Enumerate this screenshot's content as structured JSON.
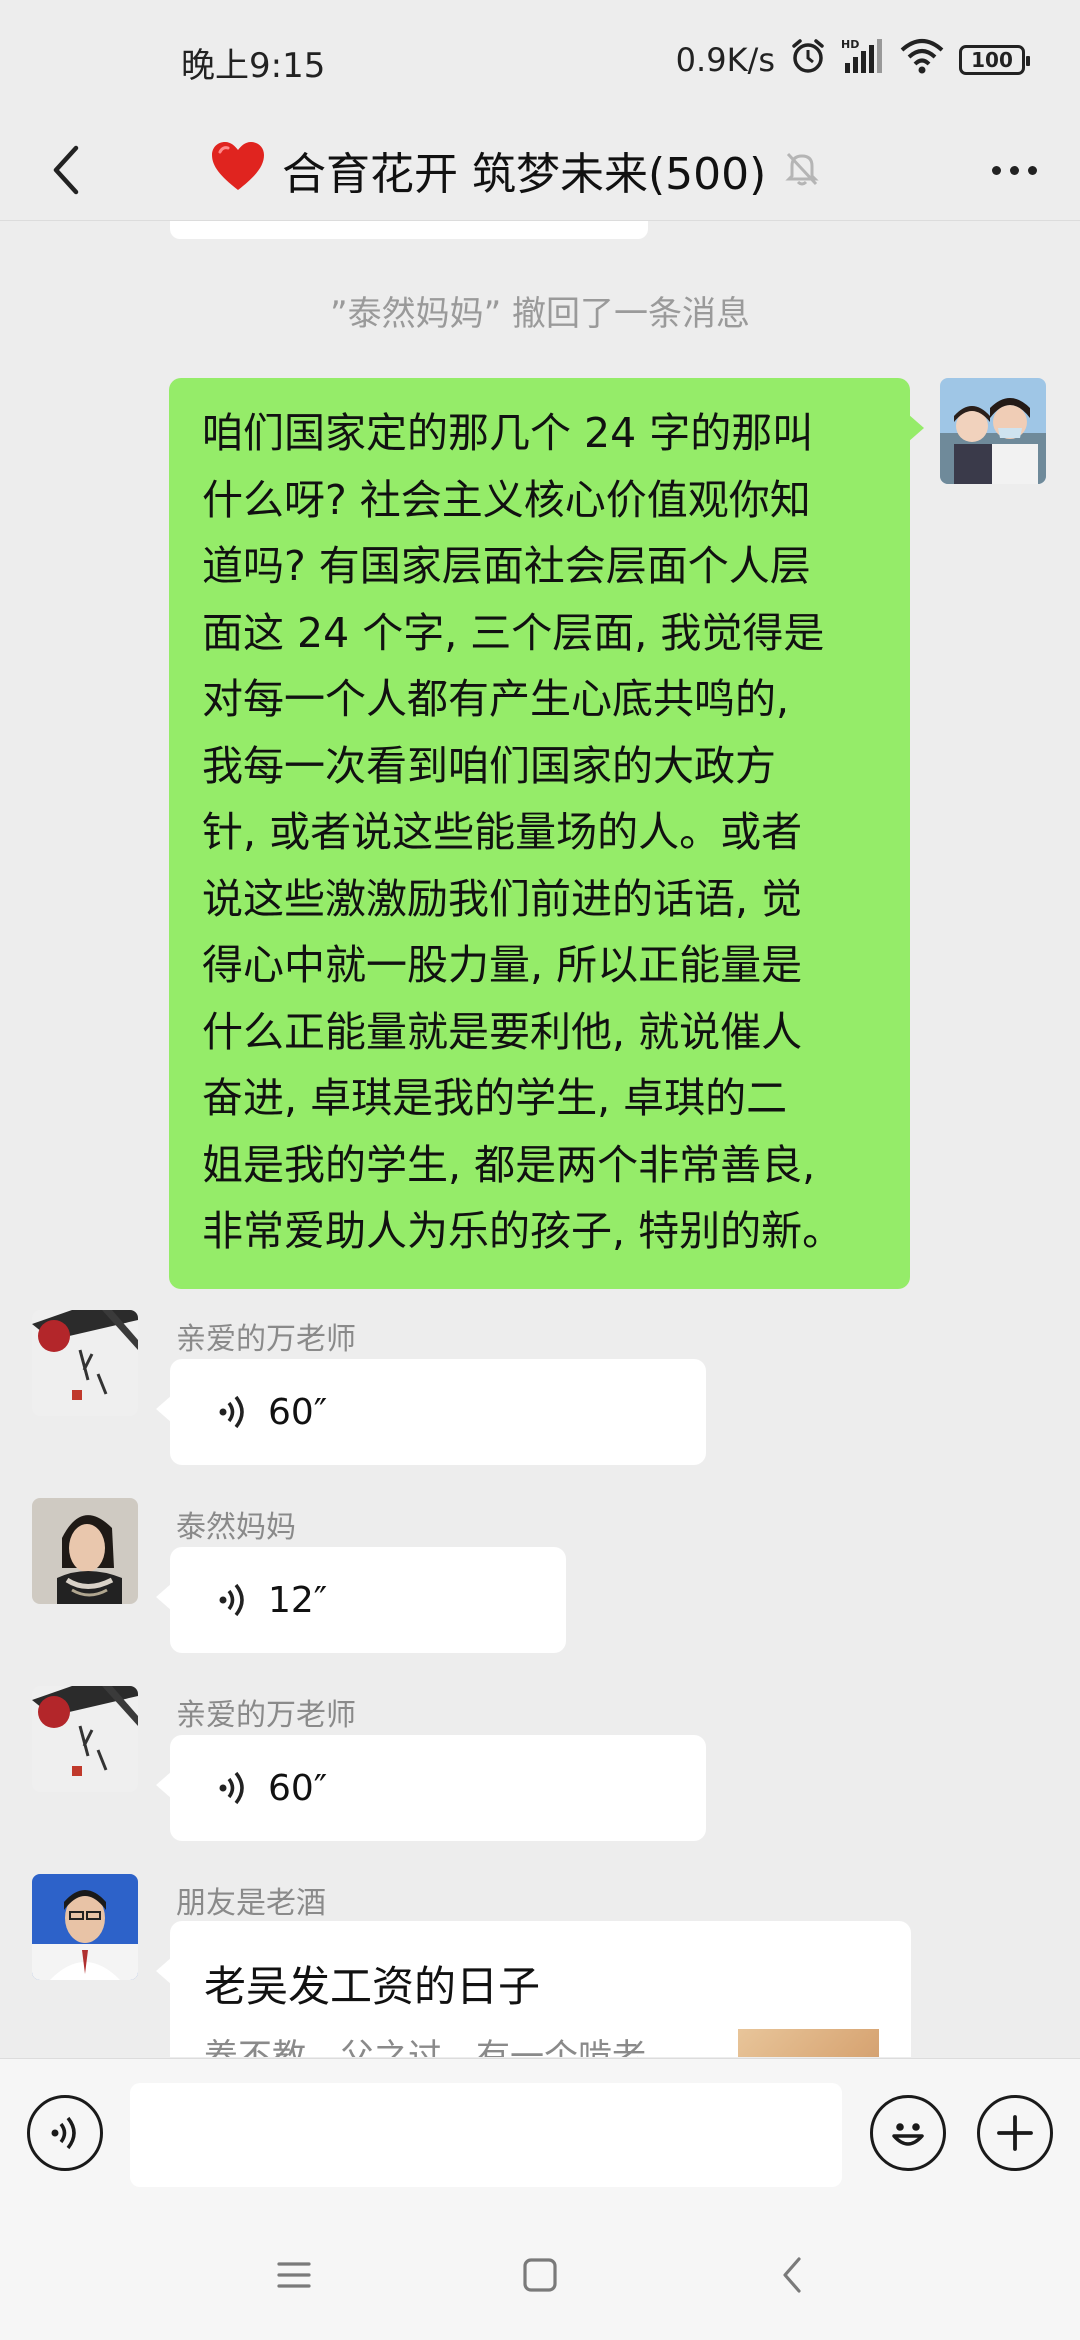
{
  "status_bar": {
    "time": "晚上9:15",
    "net_speed": "0.9K/s",
    "battery": "100",
    "icons": [
      "alarm-icon",
      "signal-hd-icon",
      "wifi-icon",
      "battery-icon"
    ]
  },
  "header": {
    "title": "合育花开 筑梦未来(500)",
    "icons": [
      "back-icon",
      "heart-icon",
      "mute-bell-icon",
      "more-icon"
    ]
  },
  "chat": {
    "system_message": "”泰然妈妈” 撤回了一条消息",
    "my_message": {
      "lines": [
        "咱们国家定的那几个 24 字的那叫",
        "什么呀? 社会主义核心价值观你知",
        "道吗? 有国家层面社会层面个人层",
        "面这 24 个字, 三个层面, 我觉得是",
        "对每一个人都有产生心底共鸣的,",
        "我每一次看到咱们国家的大政方",
        "针, 或者说这些能量场的人。或者",
        "说这些激激励我们前进的话语, 觉",
        "得心中就一股力量, 所以正能量是",
        "什么正能量就是要利他, 就说催人",
        "奋进, 卓琪是我的学生, 卓琪的二",
        "姐是我的学生, 都是两个非常善良,",
        "非常爱助人为乐的孩子, 特别的新。"
      ]
    },
    "voice_messages": [
      {
        "sender": "亲爱的万老师",
        "duration": "60″"
      },
      {
        "sender": "泰然妈妈",
        "duration": "12″"
      },
      {
        "sender": "亲爱的万老师",
        "duration": "60″"
      }
    ],
    "card_message": {
      "sender": "朋友是老酒",
      "title": "老吴发工资的日子",
      "desc": "养不教，父之过，有一个啃老"
    }
  },
  "input_bar": {
    "placeholder": "",
    "icons": [
      "voice-input-icon",
      "emoji-icon",
      "plus-icon"
    ]
  },
  "colors": {
    "background": "#ededed",
    "my_bubble": "#95ec69",
    "other_bubble": "#ffffff"
  }
}
